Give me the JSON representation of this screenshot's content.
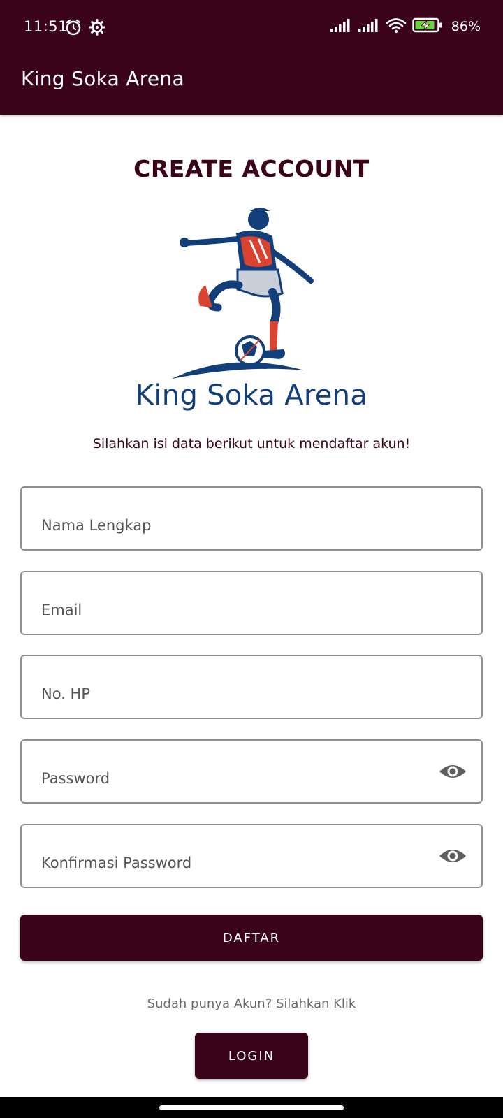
{
  "status_bar": {
    "time": "11:51",
    "battery": "86%",
    "icons": [
      "alarm-icon",
      "settings-icon",
      "signal-icon",
      "signal-icon",
      "wifi-icon",
      "battery-charging-icon"
    ]
  },
  "app_bar": {
    "title": "King Soka Arena"
  },
  "page": {
    "heading": "CREATE ACCOUNT",
    "logo_text": "King Soka Arena",
    "subtitle": "Silahkan isi data berikut untuk mendaftar akun!"
  },
  "form": {
    "full_name_placeholder": "Nama Lengkap",
    "email_placeholder": "Email",
    "phone_placeholder": "No. HP",
    "password_placeholder": "Password",
    "confirm_password_placeholder": "Konfirmasi Password",
    "submit_label": "DAFTAR"
  },
  "footer": {
    "prompt": "Sudah punya Akun? Silahkan Klik",
    "login_label": "LOGIN"
  },
  "colors": {
    "primary": "#3a031a",
    "logo_blue": "#123e7a",
    "logo_red": "#d9432f",
    "border": "#8e8e8e"
  }
}
